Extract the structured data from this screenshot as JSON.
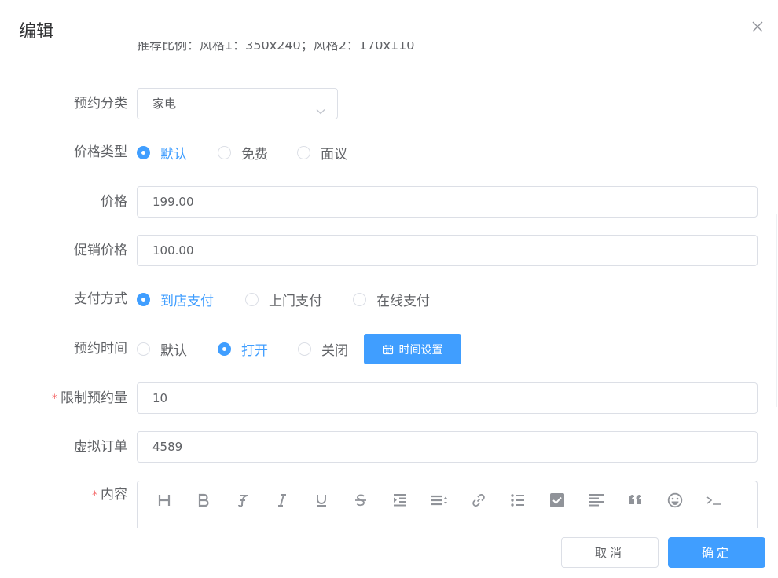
{
  "dialog": {
    "title": "编辑"
  },
  "form": {
    "hint": "推荐比例：风格1：350x240；风格2：170x110",
    "category": {
      "label": "预约分类",
      "value": "家电"
    },
    "price_type": {
      "label": "价格类型",
      "options": [
        "默认",
        "免费",
        "面议"
      ],
      "selected": "默认"
    },
    "price": {
      "label": "价格",
      "value": "199.00"
    },
    "promo_price": {
      "label": "促销价格",
      "value": "100.00"
    },
    "payment": {
      "label": "支付方式",
      "options": [
        "到店支付",
        "上门支付",
        "在线支付"
      ],
      "selected": "到店支付"
    },
    "booking_time": {
      "label": "预约时间",
      "options": [
        "默认",
        "打开",
        "关闭"
      ],
      "selected": "打开",
      "button_label": "时间设置"
    },
    "limit": {
      "label": "限制预约量",
      "required_mark": "*",
      "value": "10"
    },
    "virtual_orders": {
      "label": "虚拟订单",
      "value": "4589"
    },
    "content": {
      "label": "内容",
      "required_mark": "*"
    }
  },
  "editor_toolbar": [
    "heading-icon",
    "bold-icon",
    "font-icon",
    "italic-icon",
    "underline-icon",
    "strikethrough-icon",
    "indent-icon",
    "line-height-icon",
    "link-icon",
    "bullet-list-icon",
    "checkbox-icon",
    "align-left-icon",
    "quote-icon",
    "emoji-icon",
    "code-icon"
  ],
  "footer": {
    "cancel_label": "取消",
    "ok_label": "确定"
  },
  "colors": {
    "primary": "#409eff",
    "required": "#f56c6c",
    "border": "#dcdfe6",
    "text": "#606266"
  }
}
